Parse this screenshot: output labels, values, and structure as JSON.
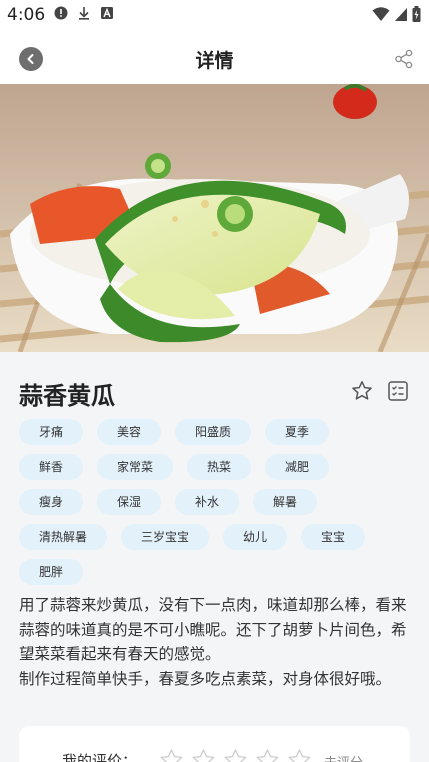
{
  "status_bar": {
    "time": "4:06",
    "left_icons": [
      "alert-icon",
      "download-icon",
      "a-icon"
    ],
    "right_icons": [
      "wifi-icon",
      "signal-icon",
      "battery-icon"
    ]
  },
  "header": {
    "title": "详情",
    "back_icon": "chevron-left-icon",
    "share_icon": "share-icon"
  },
  "recipe": {
    "title": "蒜香黄瓜",
    "favorite_icon": "star-outline-icon",
    "list_icon": "list-icon",
    "tags": [
      [
        "牙痛",
        "美容",
        "阳盛质",
        "夏季"
      ],
      [
        "鲜香",
        "家常菜",
        "热菜",
        "减肥"
      ],
      [
        "瘦身",
        "保湿",
        "补水",
        "解暑"
      ],
      [
        "清热解暑",
        "三岁宝宝",
        "幼儿",
        "宝宝"
      ],
      [
        "肥胖"
      ]
    ],
    "description": [
      "用了蒜蓉来炒黄瓜，没有下一点肉，味道却那么棒，看来蒜蓉的味道真的是不可小瞧呢。还下了胡萝卜片间色，希望菜菜看起来有春天的感觉。",
      "制作过程简单快手，春夏多吃点素菜，对身体很好哦。"
    ]
  },
  "rating": {
    "label": "我的评价：",
    "stars_filled": 0,
    "stars_total": 5,
    "status": "未评分"
  },
  "colors": {
    "tag_bg": "#e3f1fb",
    "accent": "#6e6e6e",
    "page_bg": "#f4f5f7"
  }
}
